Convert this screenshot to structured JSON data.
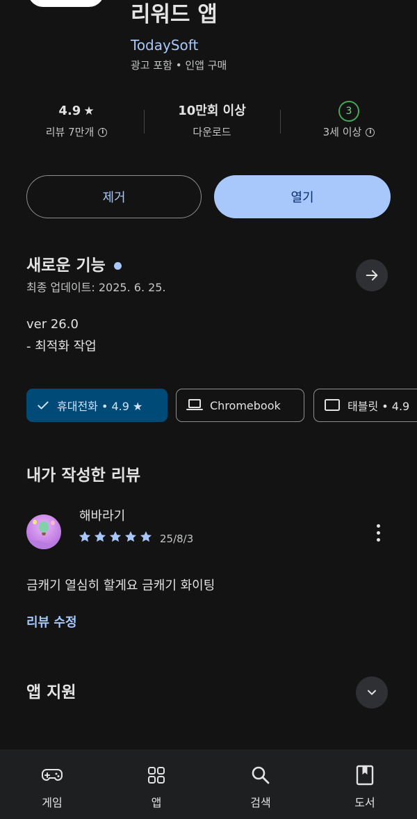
{
  "header": {
    "title": "리워드 앱",
    "developer": "TodaySoft",
    "meta": "광고 포함 • 인앱 구매"
  },
  "stats": {
    "rating": {
      "value": "4.9",
      "label": "리뷰 7만개"
    },
    "downloads": {
      "value": "10만회 이상",
      "label": "다운로드"
    },
    "age": {
      "badge": "3",
      "label": "3세 이상"
    }
  },
  "actions": {
    "remove_label": "제거",
    "open_label": "열기"
  },
  "whats_new": {
    "title": "새로운 기능",
    "updated": "최종 업데이트: 2025. 6. 25.",
    "version": "ver 26.0",
    "notes": "- 최적화 작업"
  },
  "device_chips": [
    {
      "label": "휴대전화 • 4.9 ★",
      "selected": true,
      "icon": "check-icon"
    },
    {
      "label": "Chromebook",
      "selected": false,
      "icon": "laptop-icon"
    },
    {
      "label": "태블릿 • 4.9",
      "selected": false,
      "icon": "tablet-icon"
    }
  ],
  "my_review": {
    "title": "내가 작성한 리뷰",
    "reviewer": "해바라기",
    "stars": 5,
    "date": "25/8/3",
    "text": "금캐기 열심히 할게요 금캐기 화이팅",
    "edit_label": "리뷰 수정"
  },
  "support": {
    "title": "앱 지원"
  },
  "bottom_nav": [
    {
      "label": "게임",
      "icon": "gamepad-icon"
    },
    {
      "label": "앱",
      "icon": "apps-grid-icon"
    },
    {
      "label": "검색",
      "icon": "search-icon"
    },
    {
      "label": "도서",
      "icon": "book-icon"
    }
  ],
  "colors": {
    "background": "#131314",
    "accent": "#a8c7fa",
    "selected_chip": "#004a77",
    "age_badge": "#46a758"
  }
}
